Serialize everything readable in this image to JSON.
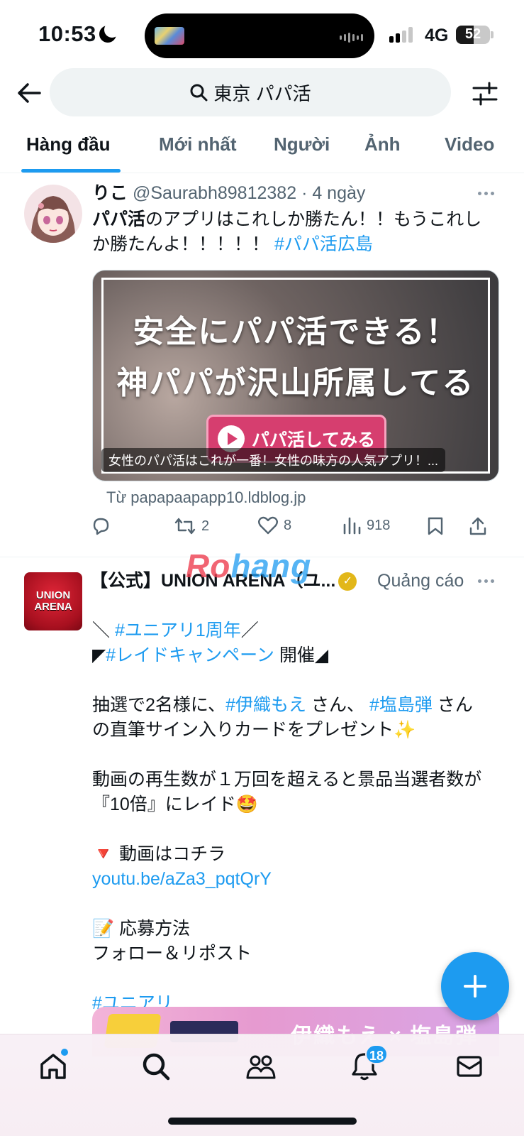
{
  "status_bar": {
    "time": "10:53",
    "network": "4G",
    "battery": "52",
    "battery_level": 0.52
  },
  "search": {
    "query": "東京 パパ活"
  },
  "tabs": [
    {
      "label": "Hàng đầu",
      "active": true
    },
    {
      "label": "Mới nhất"
    },
    {
      "label": "Người"
    },
    {
      "label": "Ảnh"
    },
    {
      "label": "Video"
    }
  ],
  "tweet1": {
    "display_name": "りこ",
    "handle": "@Saurabh89812382",
    "time": "· 4 ngày",
    "text_bold": "パパ活",
    "text_1": "のアプリはこれしか勝たん！！もうこれし",
    "text_2": "か勝たんよ！！！！！ ",
    "hashtag": "#パパ活広島",
    "card_line1": "安全にパパ活できる！",
    "card_line2": "神パパが沢山所属してる",
    "card_cta": "パパ活してみる",
    "card_caption": "女性のパパ活はこれが一番！女性の味方の人気アプリ！...",
    "card_source": "Từ papapaapapp10.ldblog.jp",
    "retweets": "2",
    "likes": "8",
    "views": "918"
  },
  "tweet2": {
    "display_name": "【公式】UNION ARENA（ユ...",
    "ad_label": "Quảng cáo",
    "avatar_text_1": "UNION",
    "avatar_text_2": "ARENA",
    "line1_pre": "＼ ",
    "line1_tag": "#ユニアリ1周年",
    "line1_post": "／",
    "line2_pre": "◤",
    "line2_tag": "#レイドキャンペーン",
    "line2_post": " 開催◢",
    "line3_pre": "抽選で2名様に、",
    "line3_tag1": "#伊織もえ",
    "line3_mid": " さん、 ",
    "line3_tag2": "#塩島弾",
    "line3_post": " さん",
    "line4": "の直筆サイン入りカードをプレゼント✨",
    "line5": "動画の再生数が１万回を超えると景品当選者数が",
    "line6": "『10倍』にレイド🤩",
    "line7": "🔻 動画はコチラ",
    "link": "youtu.be/aZa3_pqtQrY",
    "line8": "📝 応募方法",
    "line9": "フォロー＆リポスト",
    "hashtag_end": "#ユニアリ",
    "banner_text": "伊織もえ × 塩島弾"
  },
  "watermark": {
    "part1": "Ro",
    "part2": "hang"
  },
  "bottom_nav": {
    "notifications_badge": "18"
  },
  "colors": {
    "accent": "#1d9bf0",
    "text": "#0f1419",
    "muted": "#536471"
  }
}
